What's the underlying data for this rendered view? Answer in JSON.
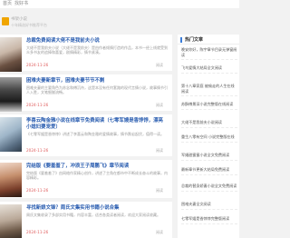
{
  "topnav": {
    "item1": "首页",
    "item2": "找好书"
  },
  "site": {
    "name": "书架小说",
    "slogan": "十年精选好书推荐平台"
  },
  "articles": [
    {
      "title": "总裁免费阅读大佬不是我前夫小说",
      "desc": "大佬不是我前夫小说（大佬不是我前夫）是由作者倾情打造的作品，本书一经上线就受到众多书友的追捧和喜爱，剧情精彩，情节紧凑。",
      "date": "2024-11-26",
      "reads": "阅读"
    },
    {
      "title": "困难夫妻新章节，困难夫妻节节不剩",
      "desc": "困难夫妻的主要角色为苏念和傅沉舟，这是本没有任何套路的现代言情小说，故事情节引人入胜，文笔细腻流畅。",
      "date": "2024-11-26",
      "reads": "阅读"
    },
    {
      "title": "李喜云陶金雅小说在线章节免费阅读（七零军嫂是香饽饽，漂亮小媳妇要宠爱）",
      "desc": "《七零军嫂是香饽饽》讲述了李喜云和陶金雅的爱情故事，情节跌宕起伏，值得一读。",
      "date": "2024-11-26",
      "reads": "阅读"
    },
    {
      "title": "完结版《要羞羞了，冲浪王子周鹏飞》章节阅读",
      "desc": "完结版《要羞羞了》由网络作家精心创作，讲述了主角在都市中不断成长奋斗的故事，内容精彩。",
      "date": "2024-11-26",
      "reads": "阅读"
    },
    {
      "title": "寻找新娘文锋？周氏文集实用书籍小说合集",
      "desc": "周氏文集收录了多部实用书籍，内容丰富，适合各类读者阅读，欢迎大家阅读收藏。",
      "date": "2024-11-26",
      "reads": "阅读"
    }
  ],
  "sidebar": {
    "heading": "热门文章",
    "items": [
      "晚安你好，陈宇章节目录无弹窗阅读",
      "飞鸟爱情大结局全文阅读",
      "第十八章家庭 被偷走的人生在线阅读",
      "苏酥傅景深小说完整版在线阅读",
      "大佬不是我前夫小说阅读",
      "重生八零有空间 小说完整版在线",
      "军婚甜蜜蜜小说全文免费阅读",
      "最新章节更新大结局免费阅读",
      "总裁的替身娇妻小说全文免费阅读",
      "困难夫妻全文阅读",
      "七零军嫂是香饽饽完整版阅读"
    ]
  }
}
